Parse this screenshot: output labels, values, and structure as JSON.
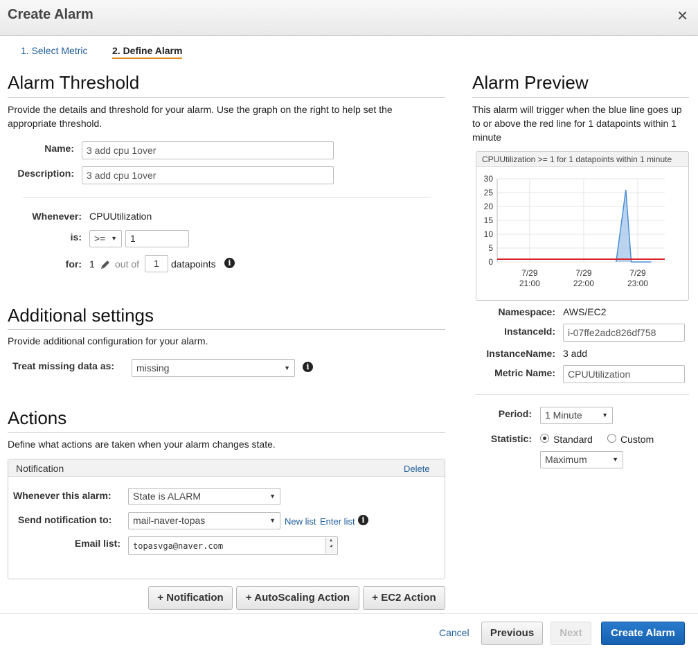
{
  "header": {
    "title": "Create Alarm",
    "close_glyph": "×"
  },
  "steps": [
    {
      "label": "1. Select Metric"
    },
    {
      "label": "2. Define Alarm"
    }
  ],
  "threshold": {
    "heading": "Alarm Threshold",
    "description": "Provide the details and threshold for your alarm. Use the graph on the right to help set the appropriate threshold.",
    "name_label": "Name:",
    "name_value": "3 add cpu 1over",
    "description_label": "Description:",
    "description_value": "3 add cpu 1over",
    "whenever_label": "Whenever:",
    "whenever_value": "CPUUtilization",
    "is_label": "is:",
    "operator": ">=",
    "threshold_value": "1",
    "for_label": "for:",
    "for_value": "1",
    "out_of": "out of",
    "out_of_value": "1",
    "datapoints": "datapoints"
  },
  "additional": {
    "heading": "Additional settings",
    "description": "Provide additional configuration for your alarm.",
    "missing_label": "Treat missing data as:",
    "missing_value": "missing"
  },
  "actions": {
    "heading": "Actions",
    "description": "Define what actions are taken when your alarm changes state.",
    "panel_title": "Notification",
    "delete_label": "Delete",
    "whenever_label": "Whenever this alarm:",
    "whenever_value": "State is ALARM",
    "send_label": "Send notification to:",
    "send_value": "mail-naver-topas",
    "new_list": "New list",
    "enter_list": "Enter list",
    "email_label": "Email list:",
    "email_value": "topasvga@naver.com",
    "add_notification": "+ Notification",
    "add_autoscaling": "+ AutoScaling Action",
    "add_ec2": "+ EC2 Action"
  },
  "preview": {
    "heading": "Alarm Preview",
    "description": "This alarm will trigger when the blue line goes up to or above the red line for 1 datapoints within 1 minute",
    "namespace_label": "Namespace:",
    "namespace_value": "AWS/EC2",
    "instanceid_label": "InstanceId:",
    "instanceid_value": "i-07ffe2adc826df758",
    "instancename_label": "InstanceName:",
    "instancename_value": "3 add",
    "metricname_label": "Metric Name:",
    "metricname_value": "CPUUtilization",
    "period_label": "Period:",
    "period_value": "1 Minute",
    "statistic_label": "Statistic:",
    "standard_label": "Standard",
    "custom_label": "Custom",
    "statistic_value": "Maximum"
  },
  "chart_data": {
    "type": "line",
    "title": "CPUUtilization >= 1 for 1 datapoints within 1 minute",
    "xlabel": "",
    "ylabel": "",
    "x_tick_labels": [
      [
        "7/29",
        "21:00"
      ],
      [
        "7/29",
        "22:00"
      ],
      [
        "7/29",
        "23:00"
      ]
    ],
    "x_tick_hours": [
      21,
      22,
      23
    ],
    "xlim_hours": [
      20.4,
      23.5
    ],
    "ylim": [
      0,
      30
    ],
    "y_ticks": [
      0,
      5,
      10,
      15,
      20,
      25,
      30
    ],
    "grid": true,
    "threshold": 1,
    "threshold_color": "#d9232a",
    "series_color": "#4a8fd3",
    "series": [
      {
        "x_hours": [
          22.6,
          22.78,
          22.88,
          23.25
        ],
        "values": [
          0,
          26,
          0,
          0
        ]
      }
    ]
  },
  "footer": {
    "cancel": "Cancel",
    "previous": "Previous",
    "next": "Next",
    "create": "Create Alarm"
  }
}
